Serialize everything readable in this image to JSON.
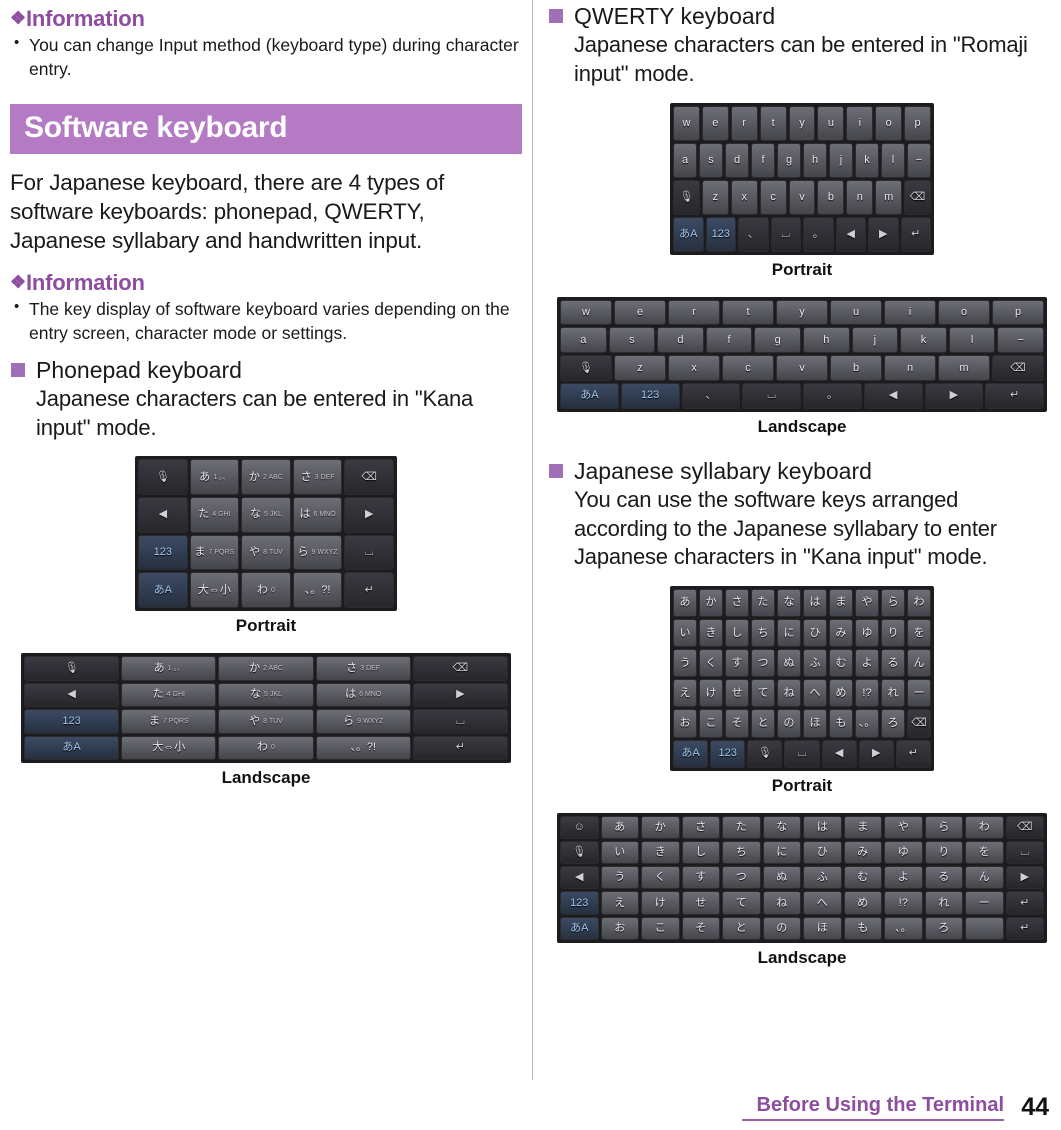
{
  "left": {
    "info1": {
      "heading": "Information",
      "diamond": "❖",
      "bullets": [
        "You can change Input method (keyboard type) during character entry."
      ]
    },
    "section_title": "Software keyboard",
    "intro": "For Japanese keyboard, there are 4 types of software keyboards: phonepad, QWERTY, Japanese syllabary and handwritten input.",
    "info2": {
      "heading": "Information",
      "diamond": "❖",
      "bullets": [
        "The key display of software keyboard varies depending on the entry screen, character mode or settings."
      ]
    },
    "sub1": {
      "title": "Phonepad keyboard",
      "body": "Japanese characters can be entered in \"Kana input\" mode.",
      "caption_portrait": "Portrait",
      "caption_landscape": "Landscape"
    }
  },
  "right": {
    "sub_qwerty": {
      "title": "QWERTY keyboard",
      "body": "Japanese characters can be entered in \"Romaji input\" mode.",
      "caption_portrait": "Portrait",
      "caption_landscape": "Landscape"
    },
    "sub_syllabary": {
      "title": "Japanese syllabary keyboard",
      "body": "You can use the software keys arranged according to the Japanese syllabary to enter Japanese characters in \"Kana input\" mode.",
      "caption_portrait": "Portrait",
      "caption_landscape": "Landscape"
    }
  },
  "footer": {
    "chapter": "Before Using the Terminal",
    "page_number": "44"
  },
  "keyboards": {
    "phonepad_portrait": {
      "rows": [
        [
          {
            "label": "🎙",
            "cls": "dark"
          },
          {
            "label": "あ",
            "sub": "1 。、",
            "cls": ""
          },
          {
            "label": "か",
            "sub": "2 ABC",
            "cls": ""
          },
          {
            "label": "さ",
            "sub": "3 DEF",
            "cls": ""
          },
          {
            "label": "⌫",
            "cls": "dark"
          }
        ],
        [
          {
            "label": "◀",
            "cls": "dark"
          },
          {
            "label": "た",
            "sub": "4 GHI",
            "cls": ""
          },
          {
            "label": "な",
            "sub": "5 JKL",
            "cls": ""
          },
          {
            "label": "は",
            "sub": "6 MNO",
            "cls": ""
          },
          {
            "label": "▶",
            "cls": "dark"
          }
        ],
        [
          {
            "label": "123",
            "cls": "blue"
          },
          {
            "label": "ま",
            "sub": "7 PQRS",
            "cls": ""
          },
          {
            "label": "や",
            "sub": "8 TUV",
            "cls": ""
          },
          {
            "label": "ら",
            "sub": "9 WXYZ",
            "cls": ""
          },
          {
            "label": "⌴",
            "cls": "dark"
          }
        ],
        [
          {
            "label": "あA",
            "cls": "blue"
          },
          {
            "label": "大⇔小",
            "cls": ""
          },
          {
            "label": "わ",
            "sub": "0",
            "cls": ""
          },
          {
            "label": "、。?!",
            "cls": ""
          },
          {
            "label": "↵",
            "cls": "dark"
          }
        ]
      ]
    },
    "phonepad_landscape": {
      "rows": [
        [
          {
            "label": "🎙",
            "cls": "dark"
          },
          {
            "label": "あ",
            "sub": "1 。、",
            "cls": ""
          },
          {
            "label": "か",
            "sub": "2 ABC",
            "cls": ""
          },
          {
            "label": "さ",
            "sub": "3 DEF",
            "cls": ""
          },
          {
            "label": "⌫",
            "cls": "dark"
          }
        ],
        [
          {
            "label": "◀",
            "cls": "dark"
          },
          {
            "label": "た",
            "sub": "4 GHI",
            "cls": ""
          },
          {
            "label": "な",
            "sub": "5 JKL",
            "cls": ""
          },
          {
            "label": "は",
            "sub": "6 MNO",
            "cls": ""
          },
          {
            "label": "▶",
            "cls": "dark"
          }
        ],
        [
          {
            "label": "123",
            "cls": "blue"
          },
          {
            "label": "ま",
            "sub": "7 PQRS",
            "cls": ""
          },
          {
            "label": "や",
            "sub": "8 TUV",
            "cls": ""
          },
          {
            "label": "ら",
            "sub": "9 WXYZ",
            "cls": ""
          },
          {
            "label": "⌴",
            "cls": "dark"
          }
        ],
        [
          {
            "label": "あA",
            "cls": "blue"
          },
          {
            "label": "大⇔小",
            "cls": ""
          },
          {
            "label": "わ",
            "sub": "0",
            "cls": ""
          },
          {
            "label": "、。?!",
            "cls": ""
          },
          {
            "label": "↵",
            "cls": "dark"
          }
        ]
      ]
    },
    "qwerty_portrait": {
      "rows": [
        [
          {
            "label": "w"
          },
          {
            "label": "e"
          },
          {
            "label": "r"
          },
          {
            "label": "t"
          },
          {
            "label": "y"
          },
          {
            "label": "u"
          },
          {
            "label": "i"
          },
          {
            "label": "o"
          },
          {
            "label": "p"
          }
        ],
        [
          {
            "label": "a"
          },
          {
            "label": "s"
          },
          {
            "label": "d"
          },
          {
            "label": "f"
          },
          {
            "label": "g"
          },
          {
            "label": "h"
          },
          {
            "label": "j"
          },
          {
            "label": "k"
          },
          {
            "label": "l"
          },
          {
            "label": "−"
          }
        ],
        [
          {
            "label": "🎙",
            "cls": "dark"
          },
          {
            "label": "z"
          },
          {
            "label": "x"
          },
          {
            "label": "c"
          },
          {
            "label": "v"
          },
          {
            "label": "b"
          },
          {
            "label": "n"
          },
          {
            "label": "m"
          },
          {
            "label": "⌫",
            "cls": "dark"
          }
        ],
        [
          {
            "label": "あA",
            "cls": "blue"
          },
          {
            "label": "123",
            "cls": "blue"
          },
          {
            "label": "、",
            "cls": "dark"
          },
          {
            "label": "⌴",
            "cls": "dark"
          },
          {
            "label": "。",
            "cls": "dark"
          },
          {
            "label": "◀",
            "cls": "dark"
          },
          {
            "label": "▶",
            "cls": "dark"
          },
          {
            "label": "↵",
            "cls": "dark"
          }
        ]
      ]
    },
    "qwerty_landscape": {
      "rows": [
        [
          {
            "label": "w"
          },
          {
            "label": "e"
          },
          {
            "label": "r"
          },
          {
            "label": "t"
          },
          {
            "label": "y"
          },
          {
            "label": "u"
          },
          {
            "label": "i"
          },
          {
            "label": "o"
          },
          {
            "label": "p"
          }
        ],
        [
          {
            "label": "a"
          },
          {
            "label": "s"
          },
          {
            "label": "d"
          },
          {
            "label": "f"
          },
          {
            "label": "g"
          },
          {
            "label": "h"
          },
          {
            "label": "j"
          },
          {
            "label": "k"
          },
          {
            "label": "l"
          },
          {
            "label": "−"
          }
        ],
        [
          {
            "label": "🎙",
            "cls": "dark"
          },
          {
            "label": "z"
          },
          {
            "label": "x"
          },
          {
            "label": "c"
          },
          {
            "label": "v"
          },
          {
            "label": "b"
          },
          {
            "label": "n"
          },
          {
            "label": "m"
          },
          {
            "label": "⌫",
            "cls": "dark"
          }
        ],
        [
          {
            "label": "あA",
            "cls": "blue"
          },
          {
            "label": "123",
            "cls": "blue"
          },
          {
            "label": "、",
            "cls": "dark"
          },
          {
            "label": "⌴",
            "cls": "dark"
          },
          {
            "label": "。",
            "cls": "dark"
          },
          {
            "label": "◀",
            "cls": "dark"
          },
          {
            "label": "▶",
            "cls": "dark"
          },
          {
            "label": "↵",
            "cls": "dark"
          }
        ]
      ]
    },
    "syllabary_portrait": {
      "rows": [
        [
          {
            "label": "あ"
          },
          {
            "label": "か"
          },
          {
            "label": "さ"
          },
          {
            "label": "た"
          },
          {
            "label": "な"
          },
          {
            "label": "は"
          },
          {
            "label": "ま"
          },
          {
            "label": "や"
          },
          {
            "label": "ら"
          },
          {
            "label": "わ"
          }
        ],
        [
          {
            "label": "い"
          },
          {
            "label": "き"
          },
          {
            "label": "し"
          },
          {
            "label": "ち"
          },
          {
            "label": "に"
          },
          {
            "label": "ひ"
          },
          {
            "label": "み"
          },
          {
            "label": "ゆ"
          },
          {
            "label": "り"
          },
          {
            "label": "を"
          }
        ],
        [
          {
            "label": "う"
          },
          {
            "label": "く"
          },
          {
            "label": "す"
          },
          {
            "label": "つ"
          },
          {
            "label": "ぬ"
          },
          {
            "label": "ふ"
          },
          {
            "label": "む"
          },
          {
            "label": "よ"
          },
          {
            "label": "る"
          },
          {
            "label": "ん"
          }
        ],
        [
          {
            "label": "え"
          },
          {
            "label": "け"
          },
          {
            "label": "せ"
          },
          {
            "label": "て"
          },
          {
            "label": "ね"
          },
          {
            "label": "へ"
          },
          {
            "label": "め"
          },
          {
            "label": "!?"
          },
          {
            "label": "れ"
          },
          {
            "label": "ー"
          }
        ],
        [
          {
            "label": "お"
          },
          {
            "label": "こ"
          },
          {
            "label": "そ"
          },
          {
            "label": "と"
          },
          {
            "label": "の"
          },
          {
            "label": "ほ"
          },
          {
            "label": "も"
          },
          {
            "label": "、。"
          },
          {
            "label": "ろ"
          },
          {
            "label": "⌫",
            "cls": "dark"
          }
        ],
        [
          {
            "label": "あA",
            "cls": "blue"
          },
          {
            "label": "123",
            "cls": "blue"
          },
          {
            "label": "🎙",
            "cls": "dark"
          },
          {
            "label": "⌴",
            "cls": "dark"
          },
          {
            "label": "◀",
            "cls": "dark"
          },
          {
            "label": "▶",
            "cls": "dark"
          },
          {
            "label": "↵",
            "cls": "dark"
          }
        ]
      ]
    },
    "syllabary_landscape": {
      "rows": [
        [
          {
            "label": "☺",
            "cls": "dark"
          },
          {
            "label": "あ"
          },
          {
            "label": "か"
          },
          {
            "label": "さ"
          },
          {
            "label": "た"
          },
          {
            "label": "な"
          },
          {
            "label": "は"
          },
          {
            "label": "ま"
          },
          {
            "label": "や"
          },
          {
            "label": "ら"
          },
          {
            "label": "わ"
          },
          {
            "label": "⌫",
            "cls": "dark"
          }
        ],
        [
          {
            "label": "🎙",
            "cls": "dark"
          },
          {
            "label": "い"
          },
          {
            "label": "き"
          },
          {
            "label": "し"
          },
          {
            "label": "ち"
          },
          {
            "label": "に"
          },
          {
            "label": "ひ"
          },
          {
            "label": "み"
          },
          {
            "label": "ゆ"
          },
          {
            "label": "り"
          },
          {
            "label": "を"
          },
          {
            "label": "⌴",
            "cls": "dark"
          }
        ],
        [
          {
            "label": "◀",
            "cls": "dark"
          },
          {
            "label": "う"
          },
          {
            "label": "く"
          },
          {
            "label": "す"
          },
          {
            "label": "つ"
          },
          {
            "label": "ぬ"
          },
          {
            "label": "ふ"
          },
          {
            "label": "む"
          },
          {
            "label": "よ"
          },
          {
            "label": "る"
          },
          {
            "label": "ん"
          },
          {
            "label": "▶",
            "cls": "dark"
          }
        ],
        [
          {
            "label": "123",
            "cls": "blue"
          },
          {
            "label": "え"
          },
          {
            "label": "け"
          },
          {
            "label": "せ"
          },
          {
            "label": "て"
          },
          {
            "label": "ね"
          },
          {
            "label": "へ"
          },
          {
            "label": "め"
          },
          {
            "label": "!?"
          },
          {
            "label": "れ"
          },
          {
            "label": "ー"
          },
          {
            "label": "↵",
            "cls": "dark"
          }
        ],
        [
          {
            "label": "あA",
            "cls": "blue"
          },
          {
            "label": "お"
          },
          {
            "label": "こ"
          },
          {
            "label": "そ"
          },
          {
            "label": "と"
          },
          {
            "label": "の"
          },
          {
            "label": "ほ"
          },
          {
            "label": "も"
          },
          {
            "label": "、。"
          },
          {
            "label": "ろ"
          },
          {
            "label": "　"
          },
          {
            "label": "↵",
            "cls": "dark"
          }
        ]
      ]
    }
  }
}
